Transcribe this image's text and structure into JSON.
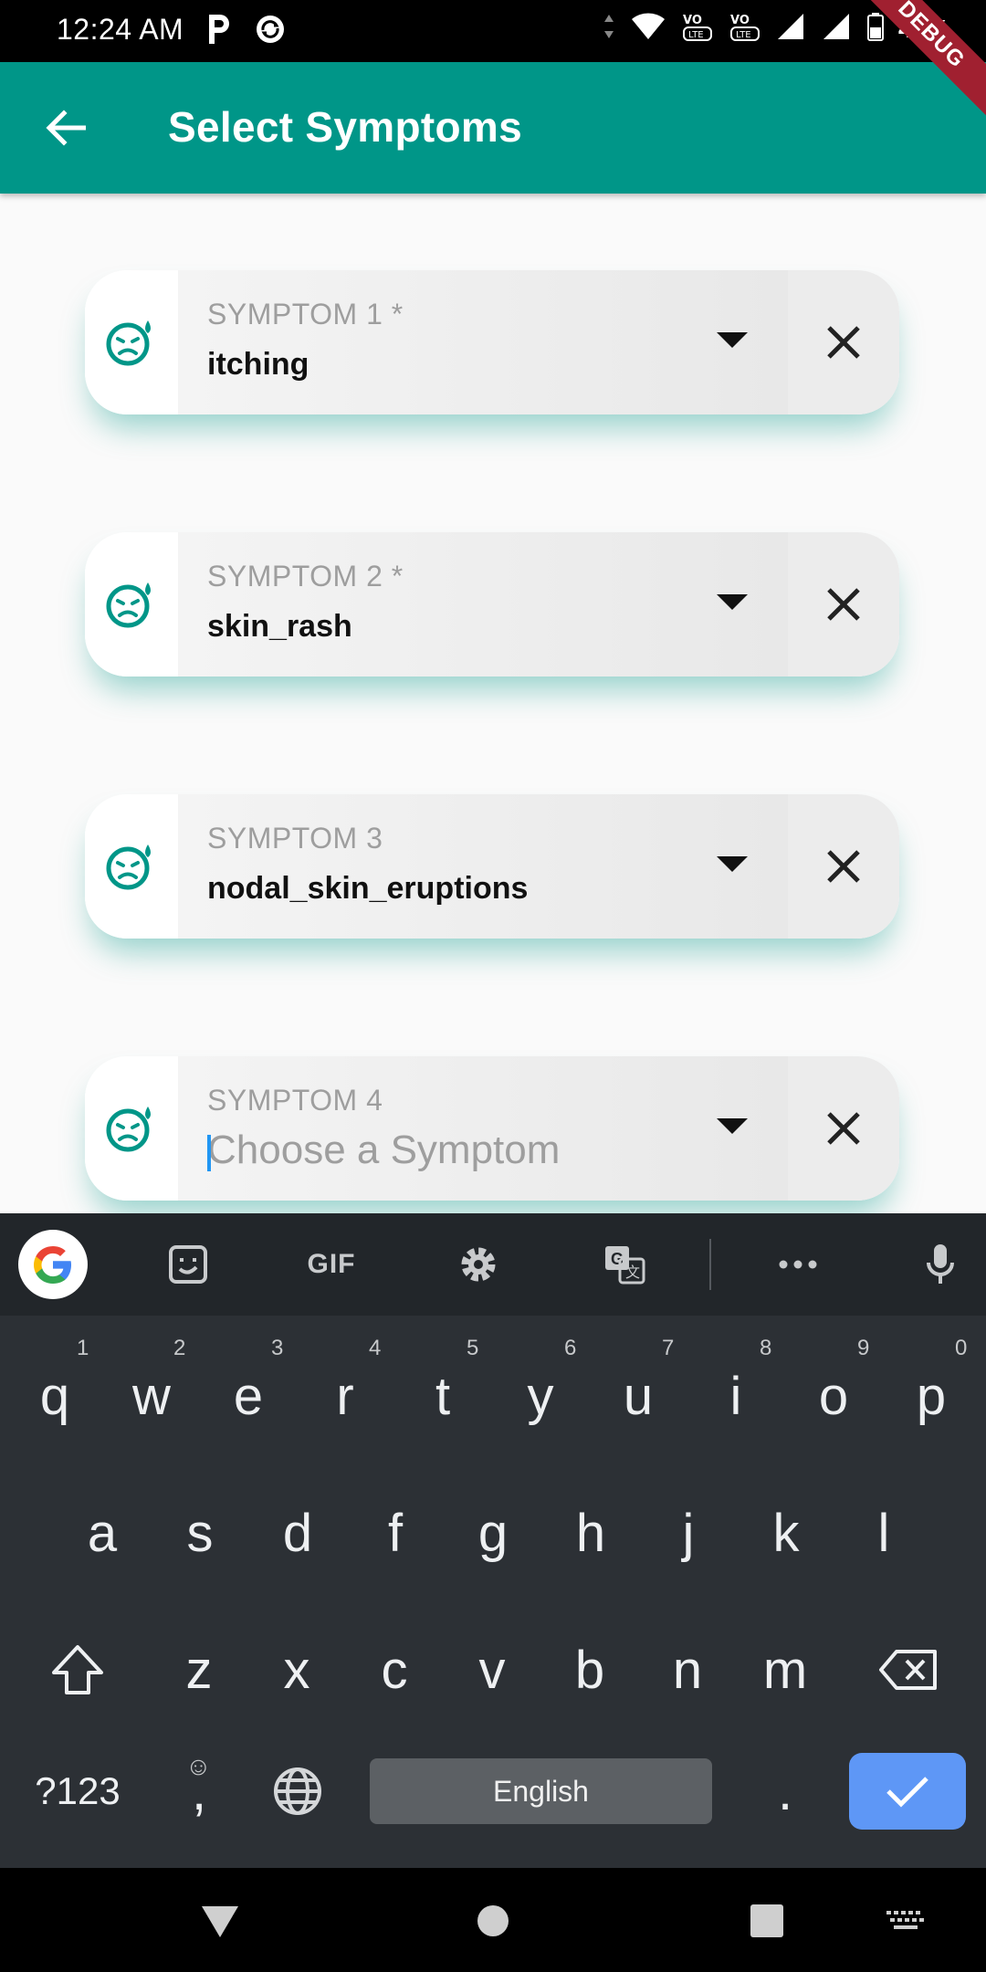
{
  "status_bar": {
    "time": "12:24 AM",
    "battery": "44%",
    "debug_banner": "DEBUG",
    "left_icons": [
      "parking-icon",
      "sync-icon"
    ],
    "right_icons": [
      "data-arrows-icon",
      "wifi-icon",
      "volte-1-icon",
      "volte-2-icon",
      "signal-1-icon",
      "signal-2-icon",
      "battery-icon"
    ]
  },
  "app_bar": {
    "title": "Select Symptoms",
    "back_icon": "arrow-back-icon",
    "color": "#009688"
  },
  "symptoms": [
    {
      "label": "SYMPTOM 1 *",
      "value": "itching",
      "placeholder": ""
    },
    {
      "label": "SYMPTOM 2 *",
      "value": "skin_rash",
      "placeholder": ""
    },
    {
      "label": "SYMPTOM 3",
      "value": "nodal_skin_eruptions",
      "placeholder": ""
    },
    {
      "label": "SYMPTOM 4",
      "value": "",
      "placeholder": "Choose a Symptom"
    }
  ],
  "symptom_icon": "sick-face-icon",
  "keyboard": {
    "toolbar": [
      "google-icon",
      "sticker-icon",
      "GIF",
      "settings-icon",
      "translate-icon",
      "more-icon",
      "mic-icon"
    ],
    "gif_label": "GIF",
    "row1": [
      "q",
      "w",
      "e",
      "r",
      "t",
      "y",
      "u",
      "i",
      "o",
      "p"
    ],
    "row1_hints": [
      "1",
      "2",
      "3",
      "4",
      "5",
      "6",
      "7",
      "8",
      "9",
      "0"
    ],
    "row2": [
      "a",
      "s",
      "d",
      "f",
      "g",
      "h",
      "j",
      "k",
      "l"
    ],
    "row3": [
      "z",
      "x",
      "c",
      "v",
      "b",
      "n",
      "m"
    ],
    "symbols_key": "?123",
    "comma_key": ",",
    "emoji_hint": "☺",
    "space_label": "English",
    "period_key": ".",
    "accent": "#5e97f6"
  },
  "nav_bar": {
    "buttons": [
      "back-triangle-icon",
      "home-circle-icon",
      "recents-square-icon",
      "keyboard-switch-icon"
    ]
  }
}
